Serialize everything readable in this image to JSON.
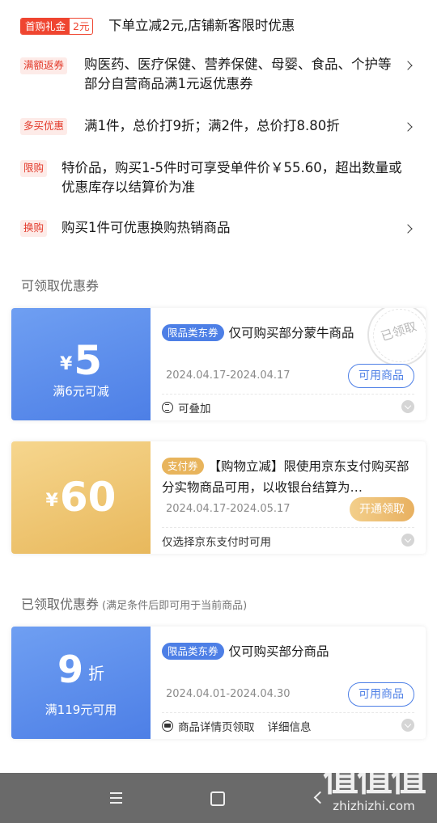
{
  "promotions": [
    {
      "tag": "首购礼金",
      "tag_value": "2元",
      "text": "下单立减2元,店铺新客限时优惠"
    },
    {
      "tag": "满额返券",
      "text": "购医药、医疗保健、营养保健、母婴、食品、个护等部分自营商品满1元返优惠券"
    },
    {
      "tag": "多买优惠",
      "text": "满1件，总价打9折；满2件，总价打8.80折"
    },
    {
      "tag": "限购",
      "text": "特价品，购买1-5件时可享受单件价￥55.60，超出数量或优惠库存以结算价为准"
    },
    {
      "tag": "换购",
      "text": "购买1件可优惠换购热销商品"
    }
  ],
  "available_section": {
    "title": "可领取优惠券"
  },
  "received_section": {
    "title": "已领取优惠券",
    "note": "(满足条件后即可用于当前商品)"
  },
  "coupons": [
    {
      "currency": "¥",
      "amount": "5",
      "condition": "满6元可减",
      "badge": "限品类东券",
      "title": "仅可购买部分蒙牛商品",
      "date": "2024.04.17-2024.04.17",
      "button": "可用商品",
      "footer": "可叠加",
      "stamp": "已领取",
      "color": "#4d7fe6"
    },
    {
      "currency": "¥",
      "amount": "60",
      "condition": "",
      "badge": "支付券",
      "title": "【购物立减】限使用京东支付购买部分实物商品可用，以收银台结算为…",
      "date": "2024.04.17-2024.05.17",
      "button": "开通领取",
      "footer": "仅选择京东支付时可用",
      "color": "#e8b45c"
    },
    {
      "amount": "9",
      "unit": "折",
      "condition": "满119元可用",
      "badge": "限品类东券",
      "title": "仅可购买部分商品",
      "date": "2024.04.01-2024.04.30",
      "button": "可用商品",
      "footer": "商品详情页领取",
      "footer_extra": "详细信息",
      "color": "#4d7fe6"
    }
  ],
  "icons": {
    "chevron": "chevron-right-icon",
    "stack": "stack-icon",
    "card": "card-icon",
    "expand": "chevron-down-icon"
  },
  "navbar": {
    "menu": "menu-icon",
    "home": "home-icon",
    "back": "back-icon"
  },
  "watermark": {
    "logo": "值值值",
    "url": "zhizhizhi.com"
  }
}
